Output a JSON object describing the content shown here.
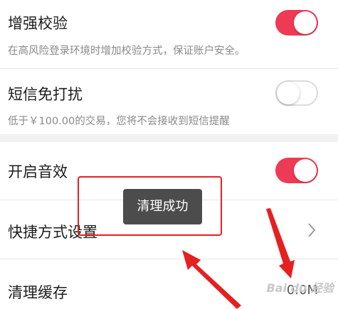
{
  "settings": {
    "enhanced_verification": {
      "title": "增强校验",
      "description": "在高风险登录环境时增加校验方式，保证账户安全。",
      "enabled": true
    },
    "sms_no_disturb": {
      "title": "短信免打扰",
      "description": "低于￥100.00的交易，您将不会接收到短信提醒",
      "enabled": false
    },
    "sound_effects": {
      "title": "开启音效",
      "enabled": true
    },
    "shortcut_settings": {
      "title": "快捷方式设置"
    },
    "clear_cache": {
      "title": "清理缓存",
      "value": "0.0M"
    }
  },
  "toast": {
    "message": "清理成功"
  },
  "colors": {
    "toggle_on": "#ee3a55",
    "annotation_red": "#e52020"
  },
  "watermark": "Bai du 经验"
}
